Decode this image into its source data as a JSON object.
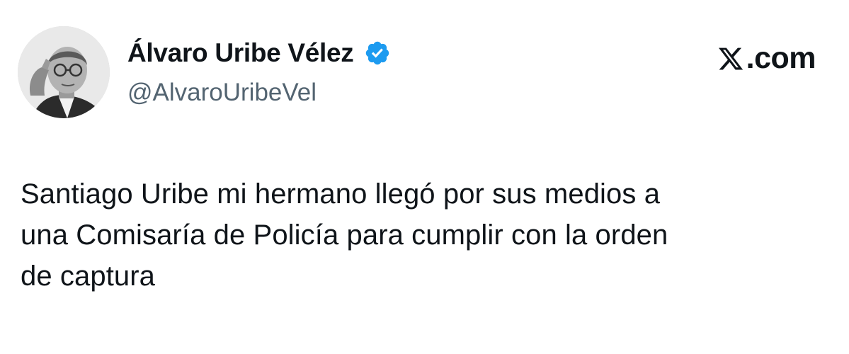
{
  "author": {
    "display_name": "Álvaro Uribe Vélez",
    "handle": "@AlvaroUribeVel",
    "verified": true,
    "avatar_icon": "profile-photo",
    "verified_icon": "verified-badge-icon"
  },
  "brand": {
    "label": ".com",
    "logo_icon": "x-logo-icon"
  },
  "tweet": {
    "lines": [
      "Santiago Uribe mi hermano llegó por sus medios a",
      "una Comisaría de Policía para cumplir con la orden",
      "de captura"
    ]
  },
  "colors": {
    "text": "#0f1419",
    "secondary_text": "#536471",
    "verified_blue": "#1d9bf0",
    "background": "#ffffff"
  }
}
